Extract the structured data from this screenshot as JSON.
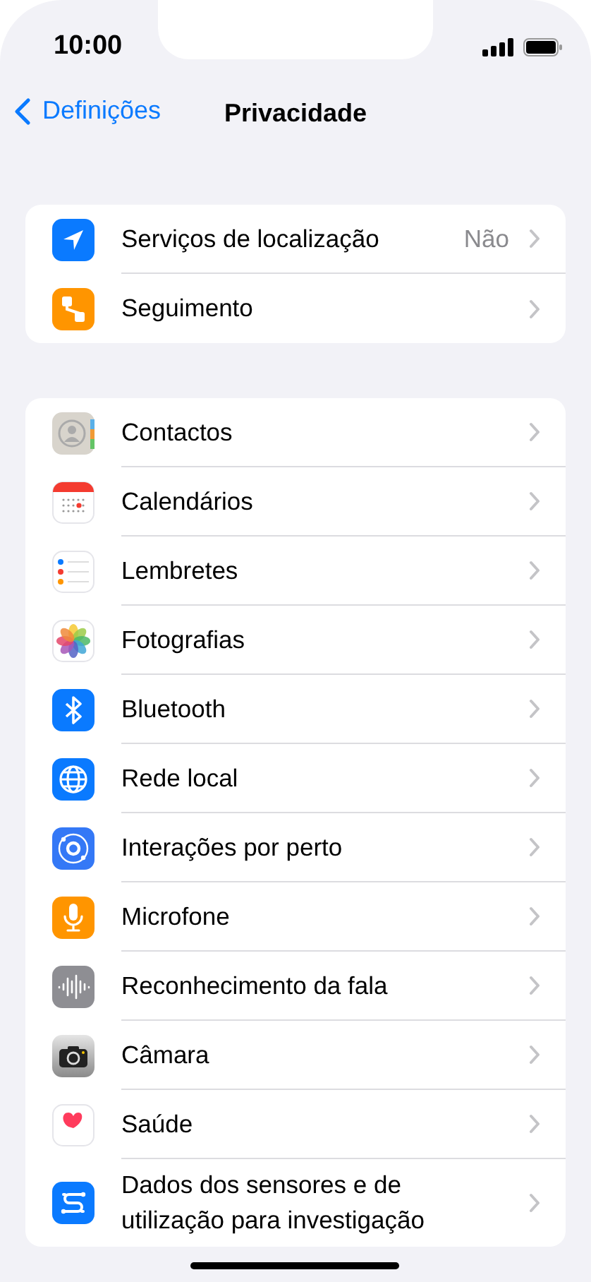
{
  "status_bar": {
    "time": "10:00"
  },
  "nav": {
    "back": "Definições",
    "title": "Privacidade"
  },
  "groups": [
    {
      "items": [
        {
          "kind": "location",
          "label": "Serviços de localização",
          "value": "Não"
        },
        {
          "kind": "tracking",
          "label": "Seguimento"
        }
      ]
    },
    {
      "items": [
        {
          "kind": "contacts",
          "label": "Contactos"
        },
        {
          "kind": "calendar",
          "label": "Calendários"
        },
        {
          "kind": "reminders",
          "label": "Lembretes"
        },
        {
          "kind": "photos",
          "label": "Fotografias"
        },
        {
          "kind": "bluetooth",
          "label": "Bluetooth"
        },
        {
          "kind": "network",
          "label": "Rede local"
        },
        {
          "kind": "nearby",
          "label": "Interações por perto"
        },
        {
          "kind": "mic",
          "label": "Microfone"
        },
        {
          "kind": "speech",
          "label": "Reconhecimento da fala"
        },
        {
          "kind": "camera",
          "label": "Câmara"
        },
        {
          "kind": "health",
          "label": "Saúde"
        },
        {
          "kind": "research",
          "label": "Dados dos sensores e de utilização para investigação"
        }
      ]
    }
  ]
}
